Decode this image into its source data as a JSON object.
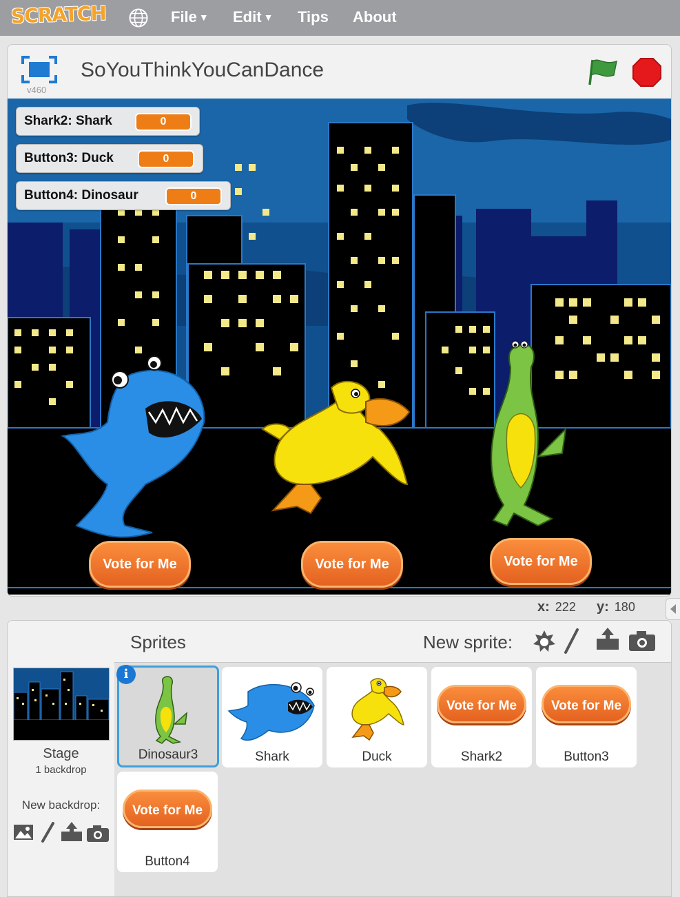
{
  "menubar": {
    "logo": "SCRATCH",
    "items": [
      {
        "label": "File",
        "has_caret": true
      },
      {
        "label": "Edit",
        "has_caret": true
      },
      {
        "label": "Tips",
        "has_caret": false
      },
      {
        "label": "About",
        "has_caret": false
      }
    ],
    "icons": [
      "globe-icon"
    ]
  },
  "stage_header": {
    "version": "v460",
    "project_title": "SoYouThinkYouCanDance",
    "icons": [
      "fullscreen-icon",
      "green-flag-icon",
      "stop-icon"
    ]
  },
  "monitors": [
    {
      "label": "Shark2: Shark",
      "value": "0"
    },
    {
      "label": "Button3: Duck",
      "value": "0"
    },
    {
      "label": "Button4: Dinosaur",
      "value": "0"
    }
  ],
  "stage_buttons": [
    {
      "label": "Vote for Me"
    },
    {
      "label": "Vote for Me"
    },
    {
      "label": "Vote for Me"
    }
  ],
  "coords": {
    "x_label": "x:",
    "x": "222",
    "y_label": "y:",
    "y": "180"
  },
  "sprites_panel": {
    "stage_label": "Stage",
    "backdrop_count": "1 backdrop",
    "new_backdrop_label": "New backdrop:",
    "sprites_title": "Sprites",
    "new_sprite_label": "New sprite:",
    "new_sprite_tools": [
      "sprite-library-icon",
      "paint-brush-icon",
      "upload-icon",
      "camera-icon"
    ],
    "new_backdrop_tools": [
      "image-library-icon",
      "paint-brush-icon",
      "upload-icon",
      "camera-icon"
    ],
    "sprites": [
      {
        "name": "Dinosaur3",
        "selected": true,
        "kind": "dinosaur"
      },
      {
        "name": "Shark",
        "selected": false,
        "kind": "shark"
      },
      {
        "name": "Duck",
        "selected": false,
        "kind": "duck"
      },
      {
        "name": "Shark2",
        "selected": false,
        "kind": "button",
        "button_label": "Vote for Me"
      },
      {
        "name": "Button3",
        "selected": false,
        "kind": "button",
        "button_label": "Vote for Me"
      },
      {
        "name": "Button4",
        "selected": false,
        "kind": "button",
        "button_label": "Vote for Me"
      }
    ],
    "info_badge": "i"
  },
  "colors": {
    "accent": "#3da0da",
    "monitor_value": "#ee7d16",
    "menubar": "#9c9ea2",
    "vote_button": "#ef7a2d"
  }
}
